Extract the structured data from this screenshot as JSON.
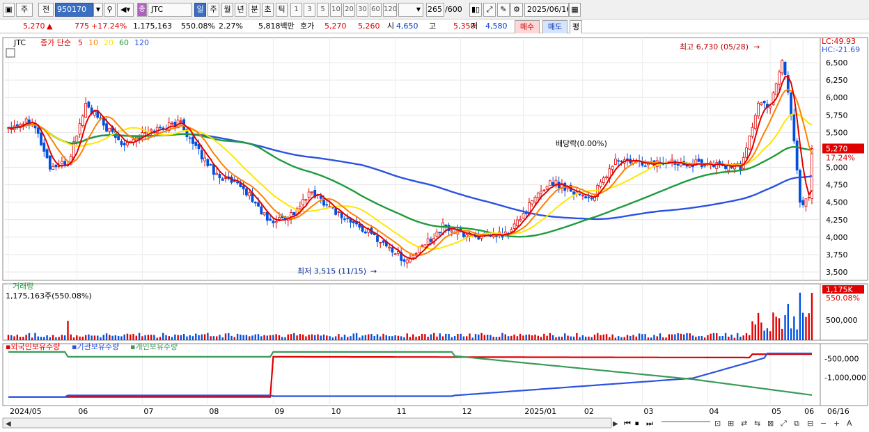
{
  "toolbar": {
    "period_label": "주",
    "prev_label": "전",
    "code": "950170",
    "stock_badge": "종",
    "stock_name": "JTC",
    "tf_day": "일",
    "tf_week": "주",
    "tf_month": "월",
    "tf_year": "년",
    "tf_min": "분",
    "tf_sec": "초",
    "tf_tick": "틱",
    "intervals": [
      "1",
      "3",
      "5",
      "10",
      "20",
      "30",
      "60",
      "120"
    ],
    "count": "265",
    "count_total": "/600",
    "date": "2025/06/16"
  },
  "quote": {
    "price": "5,270",
    "arrow": "▲",
    "change": "775",
    "change_pct": "+17.24%",
    "volume": "1,175,163",
    "vol_ratio": "550.08%",
    "turnover": "2.27%",
    "amount": "5,818백만",
    "hoga_label": "호가",
    "ask": "5,270",
    "bid": "5,260",
    "open_label": "시",
    "open": "4,650",
    "high_label": "고",
    "high": "5,350",
    "low_label": "저",
    "low": "4,580",
    "buy_label": "매수",
    "sell_label": "매도",
    "eval_label": "평"
  },
  "colors": {
    "up": "#e00000",
    "down": "#0050e0",
    "ma5": "#e00000",
    "ma10": "#ff8000",
    "ma20": "#ffe600",
    "ma60": "#1e9b3c",
    "ma120": "#2a52e0",
    "foreign": "#e00000",
    "institution": "#2a52e0",
    "individual": "#3a9a58"
  },
  "chart_data": [
    {
      "type": "candlestick",
      "title": "JTC",
      "legend": {
        "label": "종가 단순",
        "periods": [
          "5",
          "10",
          "20",
          "60",
          "120"
        ]
      },
      "y_ticks": [
        "6,500",
        "6,250",
        "6,000",
        "5,750",
        "5,500",
        "5,250",
        "5,000",
        "4,750",
        "4,500",
        "4,250",
        "4,000",
        "3,750",
        "3,500"
      ],
      "ylim": [
        3380,
        6860
      ],
      "x_labels": [
        "2024/05",
        "06",
        "07",
        "08",
        "09",
        "10",
        "11",
        "12",
        "2025/01",
        "02",
        "03",
        "04",
        "05",
        "06"
      ],
      "x_label_right": "06/16",
      "corner": {
        "lc": "LC:49.93",
        "hc": "HC:-21.69"
      },
      "last_price": "5,270",
      "last_change": "17.24%",
      "annotations": {
        "high": "최고 6,730 (05/28)",
        "low": "최저 3,515 (11/15)",
        "dividend": "배당락(0.00%)"
      },
      "anchors": [
        {
          "d": 0,
          "p": 5580
        },
        {
          "d": 8,
          "p": 5700
        },
        {
          "d": 14,
          "p": 5000
        },
        {
          "d": 20,
          "p": 5050
        },
        {
          "d": 26,
          "p": 5900
        },
        {
          "d": 32,
          "p": 5600
        },
        {
          "d": 38,
          "p": 5350
        },
        {
          "d": 50,
          "p": 5550
        },
        {
          "d": 58,
          "p": 5650
        },
        {
          "d": 62,
          "p": 5320
        },
        {
          "d": 70,
          "p": 4900
        },
        {
          "d": 80,
          "p": 4650
        },
        {
          "d": 88,
          "p": 4200
        },
        {
          "d": 96,
          "p": 4350
        },
        {
          "d": 102,
          "p": 4650
        },
        {
          "d": 112,
          "p": 4300
        },
        {
          "d": 124,
          "p": 3980
        },
        {
          "d": 134,
          "p": 3650
        },
        {
          "d": 140,
          "p": 3900
        },
        {
          "d": 146,
          "p": 4150
        },
        {
          "d": 152,
          "p": 4050
        },
        {
          "d": 160,
          "p": 4000
        },
        {
          "d": 168,
          "p": 4050
        },
        {
          "d": 176,
          "p": 4500
        },
        {
          "d": 182,
          "p": 4800
        },
        {
          "d": 188,
          "p": 4700
        },
        {
          "d": 196,
          "p": 4550
        },
        {
          "d": 204,
          "p": 5100
        },
        {
          "d": 214,
          "p": 5050
        },
        {
          "d": 224,
          "p": 5080
        },
        {
          "d": 234,
          "p": 5050
        },
        {
          "d": 246,
          "p": 5000
        },
        {
          "d": 252,
          "p": 5900
        },
        {
          "d": 256,
          "p": 5900
        },
        {
          "d": 260,
          "p": 6550
        },
        {
          "d": 262,
          "p": 6100
        },
        {
          "d": 264,
          "p": 5400
        },
        {
          "d": 266,
          "p": 4500
        },
        {
          "d": 269,
          "p": 4550
        },
        {
          "d": 270,
          "p": 5270
        }
      ]
    },
    {
      "type": "bar",
      "title": "거래량",
      "summary": "1,175,163주(550.08%)",
      "y_ticks": [
        "500,000"
      ],
      "last_value": "1,175K",
      "last_ratio": "550.08%"
    },
    {
      "type": "line",
      "series_names": [
        "외국인보유수량",
        "기관보유수량",
        "개인보유수량"
      ],
      "y_ticks": [
        "-500,000",
        "-1,000,000"
      ]
    }
  ]
}
